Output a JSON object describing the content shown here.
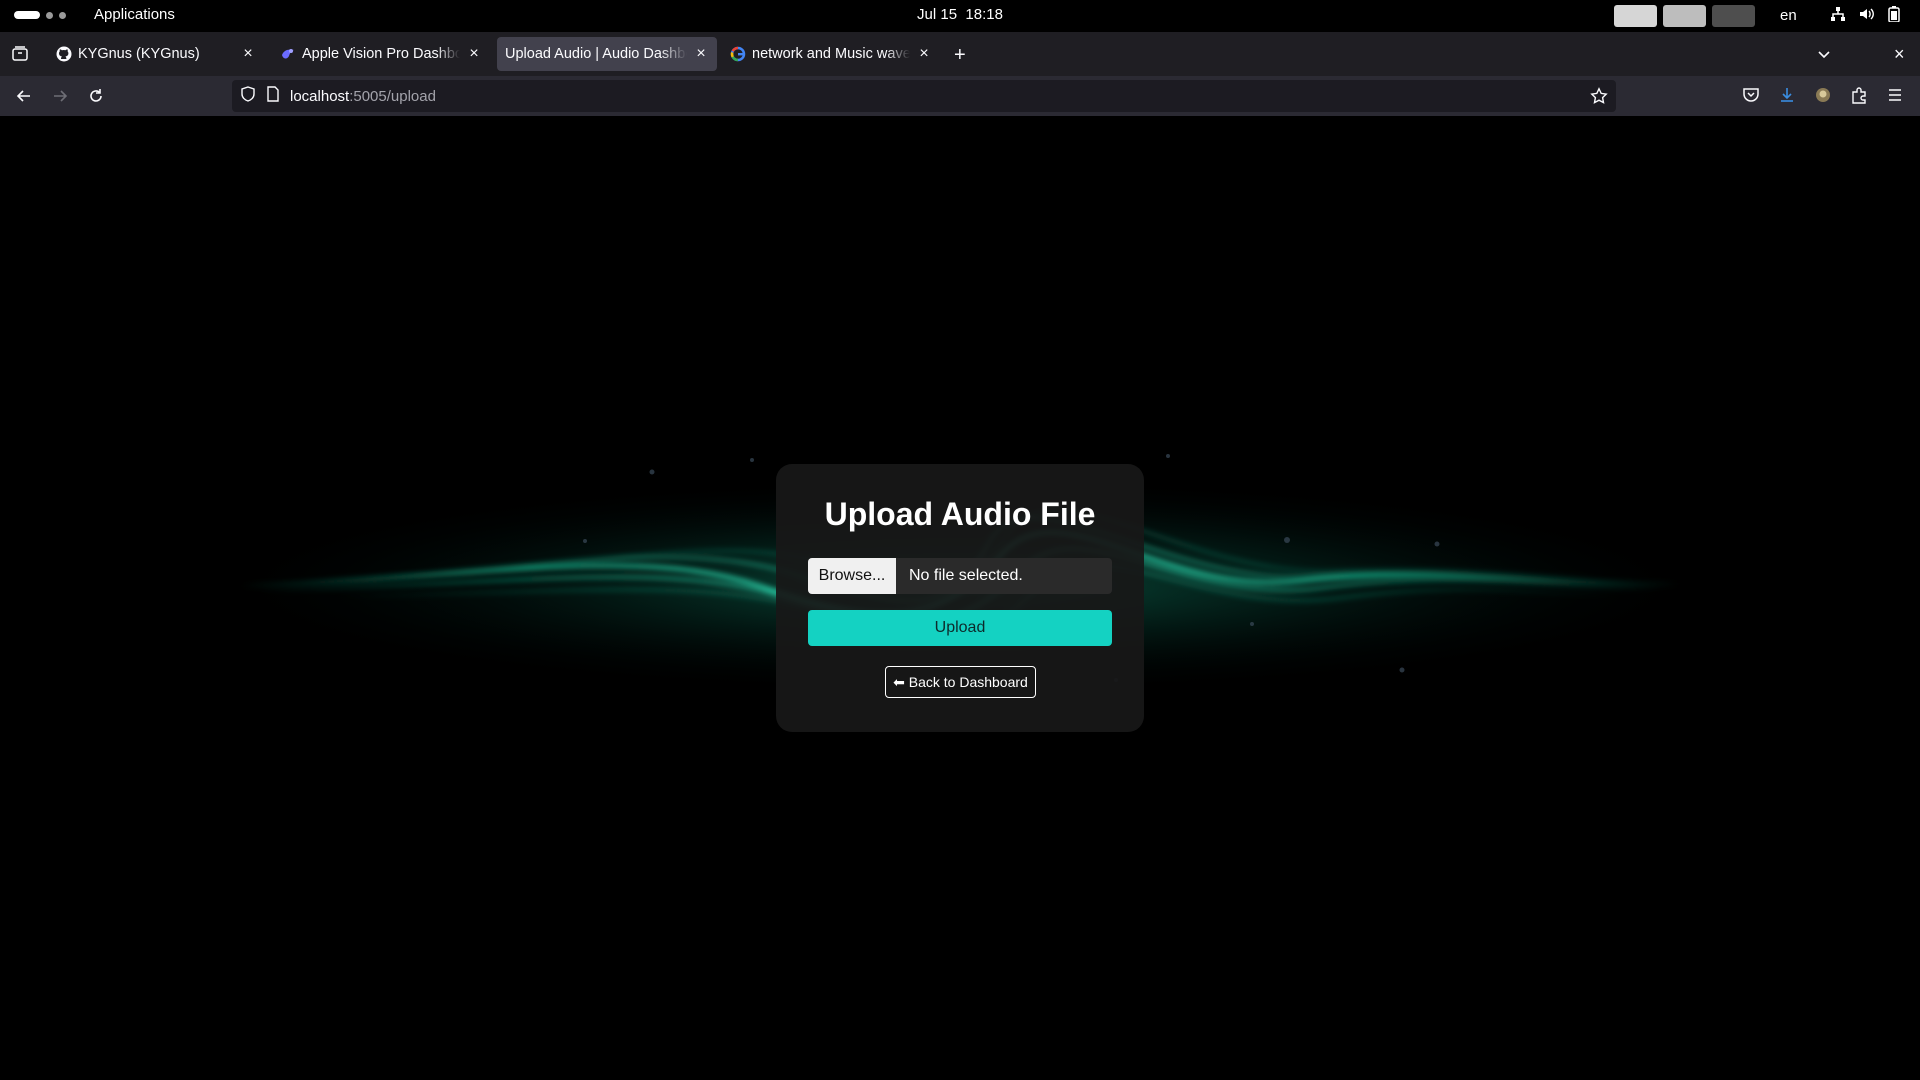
{
  "system_bar": {
    "apps_label": "Applications",
    "date": "Jul 15",
    "time": "18:18",
    "lang": "en",
    "workspace_colors": [
      "#d6d6d6",
      "#bdbdbd",
      "#4e4e4e"
    ]
  },
  "tabs": [
    {
      "title": "KYGnus (KYGnus)",
      "icon": "github-icon",
      "active": false
    },
    {
      "title": "Apple Vision Pro Dashboard",
      "icon": "app-logo-icon",
      "active": false
    },
    {
      "title": "Upload Audio | Audio Dashboard",
      "icon": "page-icon",
      "active": true
    },
    {
      "title": "network and Music waves",
      "icon": "google-icon",
      "active": false
    }
  ],
  "address": {
    "host": "localhost",
    "rest": ":5005/upload"
  },
  "page": {
    "heading": "Upload Audio File",
    "browse_label": "Browse...",
    "file_status": "No file selected.",
    "upload_label": "Upload",
    "back_label": "⬅ Back to Dashboard"
  },
  "colors": {
    "accent": "#14d2c2",
    "wave": "#1de9b6",
    "background": "#000000"
  }
}
